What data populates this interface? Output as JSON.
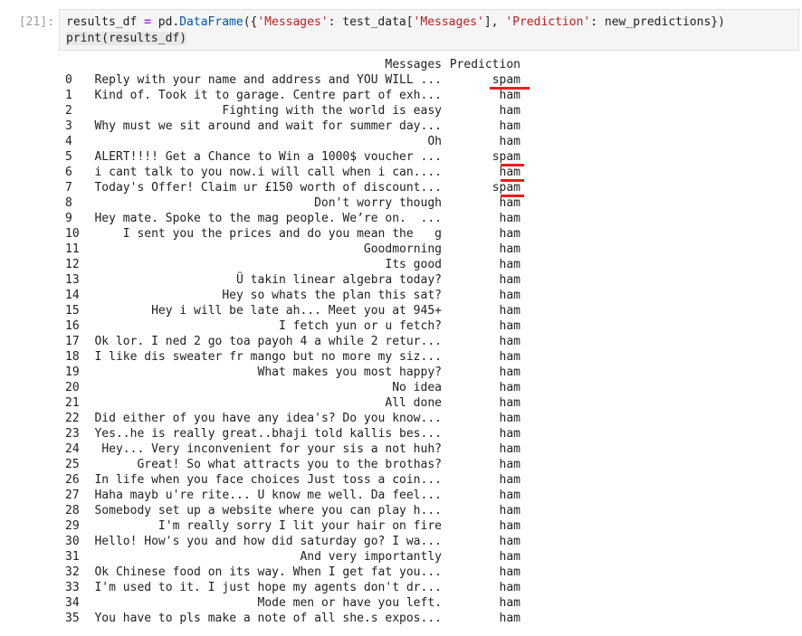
{
  "cell": {
    "prompt": "[21]:",
    "code": {
      "line1": {
        "var": "results_df ",
        "eq": "=",
        "sp": " pd.",
        "fn": "DataFrame",
        "open": "({",
        "key1": "'Messages'",
        "c1": ": test_data[",
        "key1b": "'Messages'",
        "c2": "], ",
        "key2": "'Prediction'",
        "c3": ": new_predictions})"
      },
      "line2": "print(results_df)"
    }
  },
  "output": {
    "header": {
      "messages": "Messages",
      "prediction": "Prediction"
    },
    "rows": [
      {
        "idx": "0",
        "msg": "Reply with your name and address and YOU WILL ...",
        "pred": "spam"
      },
      {
        "idx": "1",
        "msg": "Kind of. Took it to garage. Centre part of exh...",
        "pred": "ham"
      },
      {
        "idx": "2",
        "msg": "Fighting with the world is easy",
        "pred": "ham"
      },
      {
        "idx": "3",
        "msg": "Why must we sit around and wait for summer day...",
        "pred": "ham"
      },
      {
        "idx": "4",
        "msg": "Oh",
        "pred": "ham"
      },
      {
        "idx": "5",
        "msg": "ALERT!!!! Get a Chance to Win a 1000$ voucher ...",
        "pred": "spam"
      },
      {
        "idx": "6",
        "msg": "i cant talk to you now.i will call when i can....",
        "pred": "ham"
      },
      {
        "idx": "7",
        "msg": "Today's Offer! Claim ur £150 worth of discount...",
        "pred": "spam"
      },
      {
        "idx": "8",
        "msg": "Don't worry though",
        "pred": "ham"
      },
      {
        "idx": "9",
        "msg": "Hey mate. Spoke to the mag people. We’re on.  ...",
        "pred": "ham"
      },
      {
        "idx": "10",
        "msg": "I sent you the prices and do you mean the   g",
        "pred": "ham"
      },
      {
        "idx": "11",
        "msg": "Goodmorning",
        "pred": "ham"
      },
      {
        "idx": "12",
        "msg": "Its good",
        "pred": "ham"
      },
      {
        "idx": "13",
        "msg": "Ü takin linear algebra today?",
        "pred": "ham"
      },
      {
        "idx": "14",
        "msg": "Hey so whats the plan this sat?",
        "pred": "ham"
      },
      {
        "idx": "15",
        "msg": "Hey i will be late ah... Meet you at 945+",
        "pred": "ham"
      },
      {
        "idx": "16",
        "msg": "I fetch yun or u fetch?",
        "pred": "ham"
      },
      {
        "idx": "17",
        "msg": "Ok lor. I ned 2 go toa payoh 4 a while 2 retur...",
        "pred": "ham"
      },
      {
        "idx": "18",
        "msg": "I like dis sweater fr mango but no more my siz...",
        "pred": "ham"
      },
      {
        "idx": "19",
        "msg": "What makes you most happy?",
        "pred": "ham"
      },
      {
        "idx": "20",
        "msg": "No idea",
        "pred": "ham"
      },
      {
        "idx": "21",
        "msg": "All done",
        "pred": "ham"
      },
      {
        "idx": "22",
        "msg": "Did either of you have any idea's? Do you know...",
        "pred": "ham"
      },
      {
        "idx": "23",
        "msg": "Yes..he is really great..bhaji told kallis bes...",
        "pred": "ham"
      },
      {
        "idx": "24",
        "msg": "Hey... Very inconvenient for your sis a not huh?",
        "pred": "ham"
      },
      {
        "idx": "25",
        "msg": "Great! So what attracts you to the brothas?",
        "pred": "ham"
      },
      {
        "idx": "26",
        "msg": "In life when you face choices Just toss a coin...",
        "pred": "ham"
      },
      {
        "idx": "27",
        "msg": "Haha mayb u're rite... U know me well. Da feel...",
        "pred": "ham"
      },
      {
        "idx": "28",
        "msg": "Somebody set up a website where you can play h...",
        "pred": "ham"
      },
      {
        "idx": "29",
        "msg": "I'm really sorry I lit your hair on fire",
        "pred": "ham"
      },
      {
        "idx": "30",
        "msg": "Hello! How's you and how did saturday go? I wa...",
        "pred": "ham"
      },
      {
        "idx": "31",
        "msg": "And very importantly",
        "pred": "ham"
      },
      {
        "idx": "32",
        "msg": "Ok Chinese food on its way. When I get fat you...",
        "pred": "ham"
      },
      {
        "idx": "33",
        "msg": "I'm used to it. I just hope my agents don't dr...",
        "pred": "ham"
      },
      {
        "idx": "34",
        "msg": "Mode men or have you left.",
        "pred": "ham"
      },
      {
        "idx": "35",
        "msg": "You have to pls make a note of all she.s expos...",
        "pred": "ham"
      }
    ]
  },
  "annotations": {
    "underline_color": "#ee1c1c",
    "underlined_rows": [
      {
        "row": 0,
        "style": "long"
      },
      {
        "row": 5,
        "style": "short"
      },
      {
        "row": 6,
        "style": "short"
      },
      {
        "row": 7,
        "style": "short"
      }
    ]
  }
}
